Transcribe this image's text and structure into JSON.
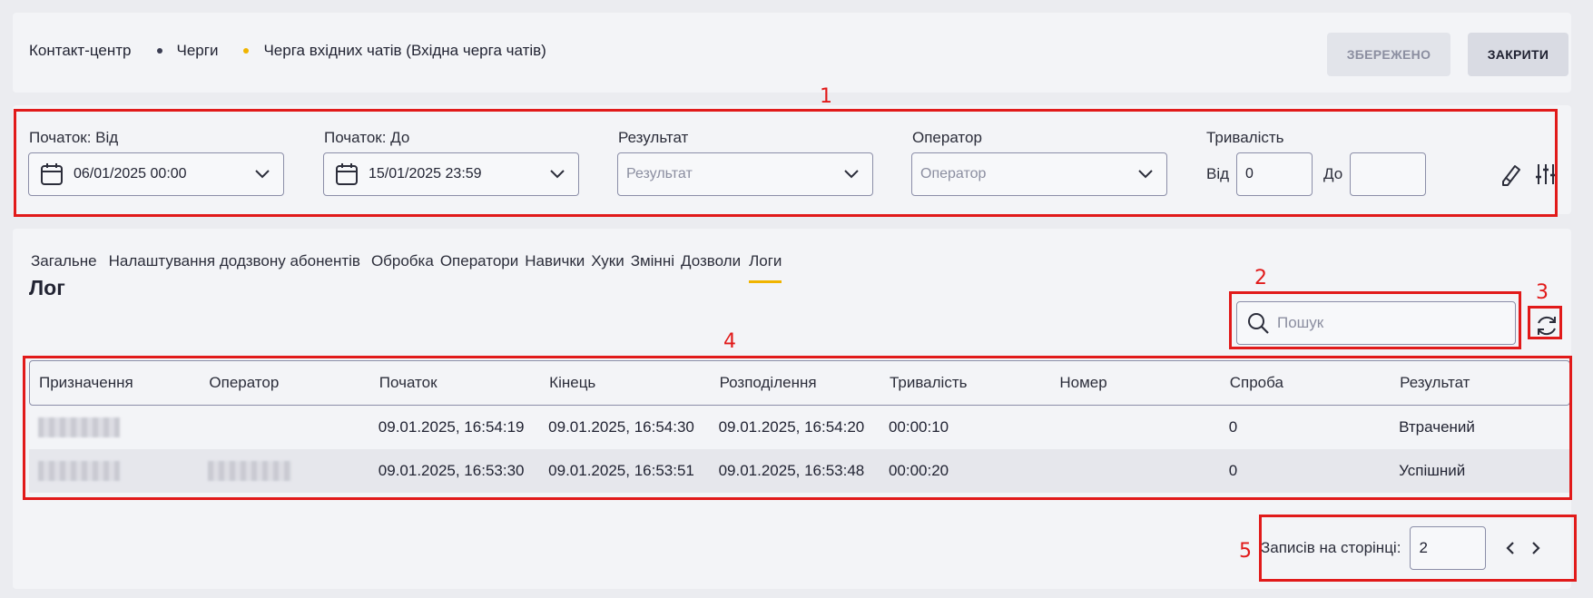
{
  "breadcrumb": {
    "items": [
      "Контакт-центр",
      "Черги",
      "Черга вхідних чатів (Вхідна черга чатів)"
    ]
  },
  "header": {
    "saved_label": "ЗБЕРЕЖЕНО",
    "close_label": "ЗАКРИТИ"
  },
  "filters": {
    "start_from": {
      "label": "Початок: Від",
      "value": "06/01/2025 00:00"
    },
    "start_to": {
      "label": "Початок: До",
      "value": "15/01/2025 23:59"
    },
    "result": {
      "label": "Результат",
      "placeholder": "Результат"
    },
    "operator": {
      "label": "Оператор",
      "placeholder": "Оператор"
    },
    "duration": {
      "label": "Тривалість",
      "from_label": "Від",
      "from_value": "0",
      "to_label": "До",
      "to_value": ""
    }
  },
  "tabs": [
    "Загальне",
    "Налаштування додзвону абонентів",
    "Обробка",
    "Оператори",
    "Навички",
    "Хуки",
    "Змінні",
    "Дозволи",
    "Логи"
  ],
  "active_tab": "Логи",
  "log": {
    "title": "Лог",
    "search_placeholder": "Пошук",
    "columns": [
      "Призначення",
      "Оператор",
      "Початок",
      "Кінець",
      "Розподілення",
      "Тривалість",
      "Номер",
      "Спроба",
      "Результат"
    ],
    "rows": [
      {
        "start": "09.01.2025, 16:54:19",
        "end": "09.01.2025, 16:54:30",
        "distribution": "09.01.2025, 16:54:20",
        "duration": "00:00:10",
        "number": "",
        "attempt": "0",
        "result": "Втрачений"
      },
      {
        "start": "09.01.2025, 16:53:30",
        "end": "09.01.2025, 16:53:51",
        "distribution": "09.01.2025, 16:53:48",
        "duration": "00:00:20",
        "number": "",
        "attempt": "0",
        "result": "Успішний"
      }
    ]
  },
  "pagination": {
    "label": "Записів на сторінці:",
    "value": "2"
  },
  "annotations": [
    "1",
    "2",
    "3",
    "4",
    "5"
  ],
  "colors": {
    "accent": "#f0b400",
    "annotation": "#e11a1a",
    "border": "#8b8ea8"
  }
}
